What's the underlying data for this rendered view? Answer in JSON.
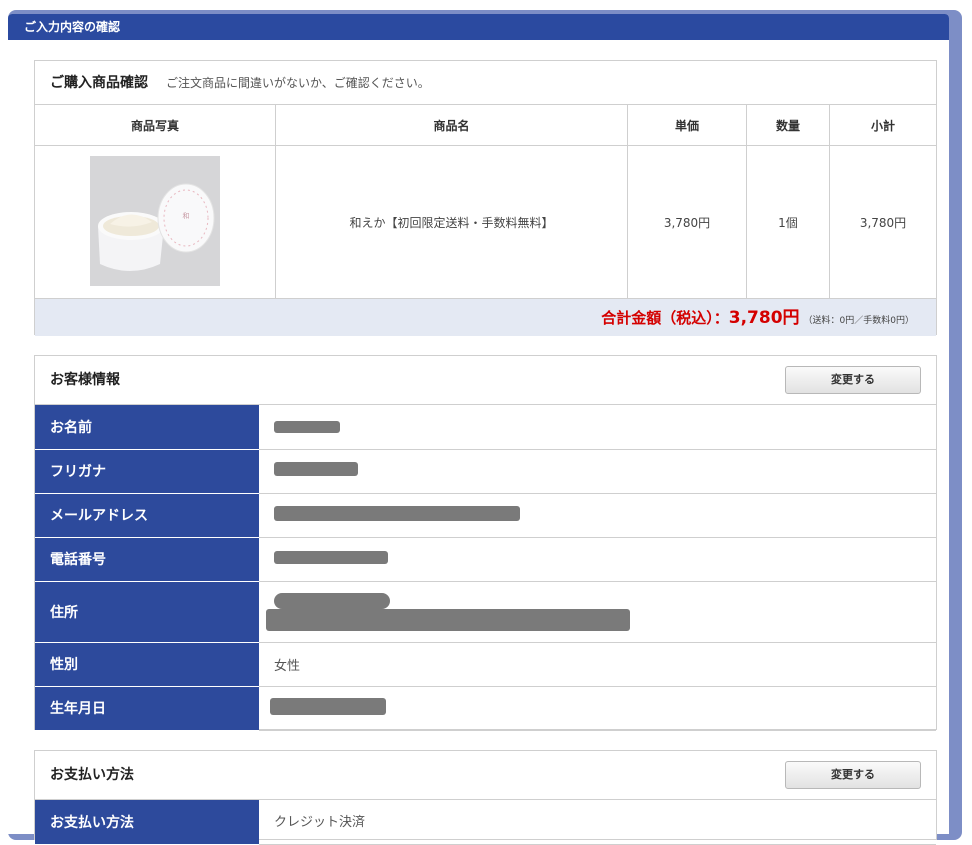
{
  "header": {
    "title": "ご入力内容の確認"
  },
  "purchase": {
    "title": "ご購入商品確認",
    "subtitle": "ご注文商品に間違いがないか、ご確認ください。",
    "columns": [
      "商品写真",
      "商品名",
      "単価",
      "数量",
      "小計"
    ],
    "item": {
      "name": "和えか【初回限定送料・手数料無料】",
      "unit_price": "3,780円",
      "quantity": "1個",
      "subtotal": "3,780円"
    },
    "total_label": "合計金額（税込）：",
    "total_amount": "3,780円",
    "total_note": "（送料：0円／手数料0円）"
  },
  "customer": {
    "title": "お客様情報",
    "change_label": "変更する",
    "rows": [
      {
        "label": "お名前"
      },
      {
        "label": "フリガナ"
      },
      {
        "label": "メールアドレス"
      },
      {
        "label": "電話番号"
      },
      {
        "label": "住所"
      },
      {
        "label": "性別",
        "value": "女性"
      },
      {
        "label": "生年月日"
      }
    ]
  },
  "payment": {
    "title": "お支払い方法",
    "change_label": "変更する",
    "row_label": "お支払い方法",
    "row_value": "クレジット決済"
  }
}
